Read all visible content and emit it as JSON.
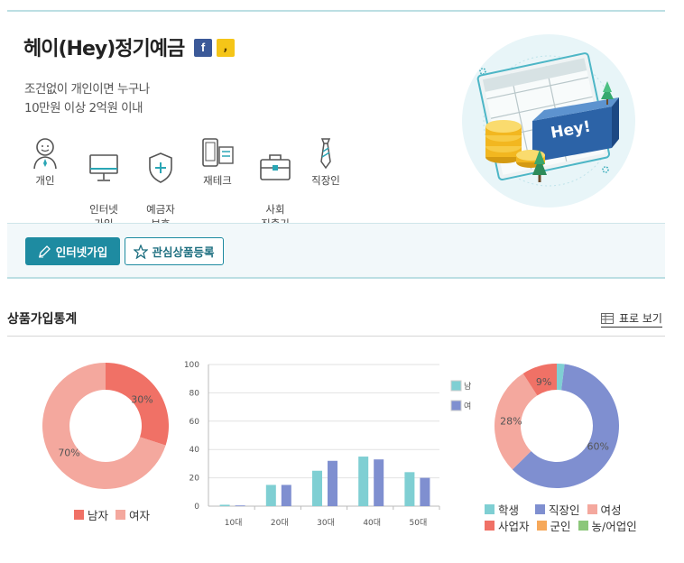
{
  "product": {
    "title": "헤이(Hey)정기예금",
    "facebook_glyph": "f",
    "kakao_glyph": ",",
    "desc_lines": [
      "조건없이 개인이면 누구나",
      "10만원 이상 2억원 이내"
    ],
    "features": [
      {
        "label": "개인",
        "icon": "person-icon"
      },
      {
        "label": "인터넷\n가입",
        "icon": "monitor-icon"
      },
      {
        "label": "예금자\n보호",
        "icon": "shield-icon"
      },
      {
        "label": "재테크",
        "icon": "mobile-icon"
      },
      {
        "label": "사회\n진출기",
        "icon": "briefcase-icon"
      },
      {
        "label": "직장인",
        "icon": "necktie-icon"
      }
    ],
    "illustration_text": "Hey!"
  },
  "buttons": {
    "join": "인터넷가입",
    "wishlist": "관심상품등록"
  },
  "stats": {
    "title": "상품가입통계",
    "table_view": "표로 보기"
  },
  "colors": {
    "teal": "#1e8ba1",
    "male": "#f07166",
    "female": "#f4a89e",
    "bar_male": "#7fcfd3",
    "bar_female": "#7f8fd0"
  },
  "chart_data": [
    {
      "type": "pie",
      "labels": [
        "남자",
        "여자"
      ],
      "values": [
        30,
        70
      ],
      "colors": [
        "#f07166",
        "#f4a89e"
      ],
      "data_labels": [
        "30%",
        "70%"
      ],
      "legend": "bottom"
    },
    {
      "type": "bar",
      "categories": [
        "10대",
        "20대",
        "30대",
        "40대",
        "50대"
      ],
      "series": [
        {
          "name": "남",
          "values": [
            1,
            15,
            25,
            35,
            24
          ],
          "color": "#7fcfd3"
        },
        {
          "name": "여",
          "values": [
            0.5,
            15,
            32,
            33,
            20
          ],
          "color": "#7f8fd0"
        }
      ],
      "ylim": [
        0,
        100
      ],
      "yticks": [
        0,
        20,
        40,
        60,
        80,
        100
      ],
      "grid": true,
      "legend": "right"
    },
    {
      "type": "pie",
      "labels": [
        "학생",
        "직장인",
        "여성",
        "사업자",
        "군인",
        "농/어업인"
      ],
      "values": [
        2,
        60,
        28,
        9,
        0,
        0
      ],
      "colors": [
        "#7fcfd3",
        "#7f8fd0",
        "#f4a89e",
        "#f07166",
        "#f6a85a",
        "#8cc77a"
      ],
      "data_labels": [
        "",
        "60%",
        "28%",
        "9%",
        "",
        ""
      ],
      "legend": "bottom"
    }
  ]
}
